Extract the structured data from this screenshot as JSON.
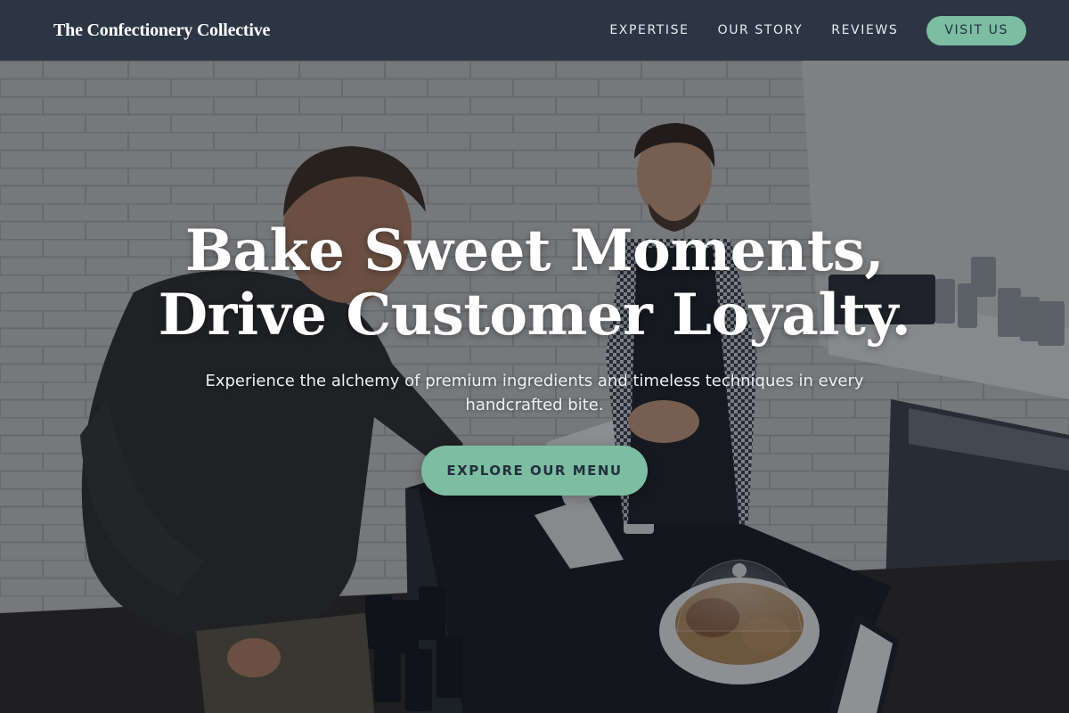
{
  "header": {
    "brand": "The Confectionery Collective",
    "nav": {
      "expertise": "EXPERTISE",
      "our_story": "OUR STORY",
      "reviews": "REVIEWS",
      "visit_us": "VISIT US"
    }
  },
  "hero": {
    "title_line1": "Bake Sweet Moments,",
    "title_line2": "Drive Customer Loyalty.",
    "subtitle": "Experience the alchemy of premium ingredients and timeless techniques in every handcrafted bite.",
    "cta": "EXPLORE OUR MENU"
  },
  "colors": {
    "header_bg": "#2c3544",
    "accent": "#7dbda1",
    "accent_text": "#233040"
  }
}
